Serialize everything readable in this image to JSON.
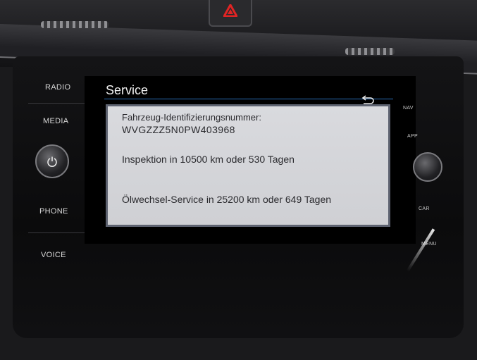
{
  "screen": {
    "title": "Service",
    "back_icon": "back-arrow-icon",
    "vin_label": "Fahrzeug-Identifizierungsnummer:",
    "vin_value": "WVGZZZ5N0PW403968",
    "inspection": "Inspektion in 10500 km oder 530 Tagen",
    "oil_service": "Ölwechsel-Service in 25200 km oder 649 Tagen"
  },
  "left_buttons": {
    "radio": "RADIO",
    "media": "MEDIA",
    "phone": "PHONE",
    "voice": "VOICE",
    "power_icon": "power-icon"
  },
  "right_buttons": {
    "nav": "NAV",
    "app": "APP",
    "car": "CAR",
    "menu": "MENU"
  },
  "colors": {
    "panel_bg": "#d6d7db",
    "panel_border": "#5d6270",
    "title_rule": "#2a6fb8",
    "hazard": "#e02424"
  }
}
